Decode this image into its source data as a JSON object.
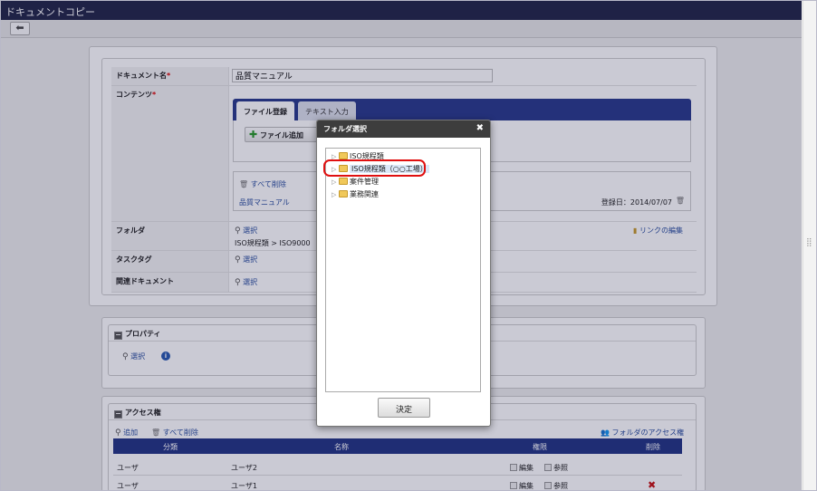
{
  "window": {
    "title": "ドキュメントコピー",
    "back_icon": "arrow-left-icon"
  },
  "form": {
    "doc_name": {
      "label": "ドキュメント名",
      "required_mark": "*",
      "value": "品質マニュアル"
    },
    "contents": {
      "label": "コンテンツ",
      "required_mark": "*",
      "tabs": [
        "ファイル登録",
        "テキスト入力"
      ],
      "add_file_label": "ファイル追加",
      "delete_all_label": "すべて削除",
      "file_name": "品質マニュアル",
      "registered_date": "登録日：2014/07/07"
    },
    "folder": {
      "label": "フォルダ",
      "select_label": "選択",
      "path": "ISO規程類 > ISO9000",
      "edit_link_label": "リンクの編集"
    },
    "task_tag": {
      "label": "タスクタグ",
      "select_label": "選択"
    },
    "related_docs": {
      "label": "関連ドキュメント",
      "select_label": "選択"
    }
  },
  "properties": {
    "title": "プロパティ",
    "select_label": "選択"
  },
  "access": {
    "title": "アクセス権",
    "add_label": "追加",
    "delete_all_label": "すべて削除",
    "folder_access_label": "フォルダのアクセス権",
    "columns": [
      "分類",
      "名称",
      "権限",
      "削除"
    ],
    "rows": [
      {
        "type": "ユーザ",
        "name": "ユーザ2",
        "perm_edit": "編集",
        "perm_view": "参照"
      },
      {
        "type": "ユーザ",
        "name": "ユーザ1",
        "perm_edit": "編集",
        "perm_view": "参照"
      }
    ]
  },
  "dialog": {
    "title": "フォルダ選択",
    "close_icon": "close-icon",
    "tree": [
      "ISO規程類",
      "ISO規程類（○○工場）",
      "案件管理",
      "業務関連"
    ],
    "ok_label": "決定"
  }
}
